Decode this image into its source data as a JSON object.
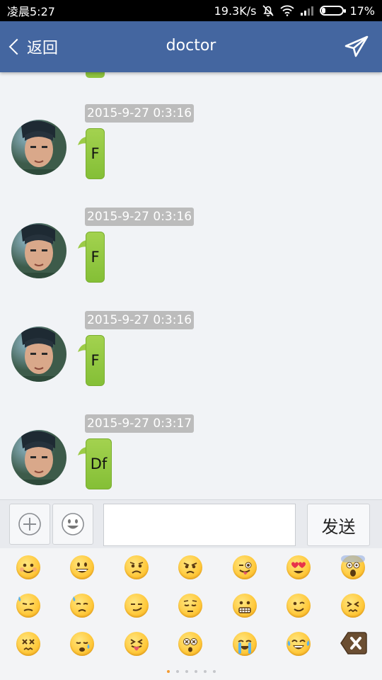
{
  "status_bar": {
    "time": "凌晨5:27",
    "network_speed": "19.3K/s",
    "battery": "17%",
    "battery_level": 0.17
  },
  "title_bar": {
    "back_label": "返回",
    "title": "doctor"
  },
  "messages": [
    {
      "timestamp": "2015-9-27 0:3:16",
      "text": "F"
    },
    {
      "timestamp": "2015-9-27 0:3:16",
      "text": "F"
    },
    {
      "timestamp": "2015-9-27 0:3:16",
      "text": "F"
    },
    {
      "timestamp": "2015-9-27 0:3:17",
      "text": "Df"
    }
  ],
  "input_bar": {
    "text_value": "",
    "send_label": "发送"
  },
  "emoji_panel": {
    "rows": [
      [
        "smile-blush",
        "grin",
        "disappointed",
        "angry",
        "wink-tongue",
        "heart-eyes",
        "scream"
      ],
      [
        "sweat",
        "disappointed-relieved",
        "smirk",
        "pensive",
        "grimace",
        "wink",
        "confounded"
      ],
      [
        "dizzy-tired",
        "sleepy",
        "tongue-squint",
        "dizzy-face",
        "sob",
        "joy"
      ]
    ],
    "page_count": 6,
    "active_page": 1
  },
  "colors": {
    "title_bar": "#4466a0",
    "bubble": "#8ec33f",
    "timestamp_bg": "#bcbcbc",
    "active_dot": "#f39c32"
  }
}
